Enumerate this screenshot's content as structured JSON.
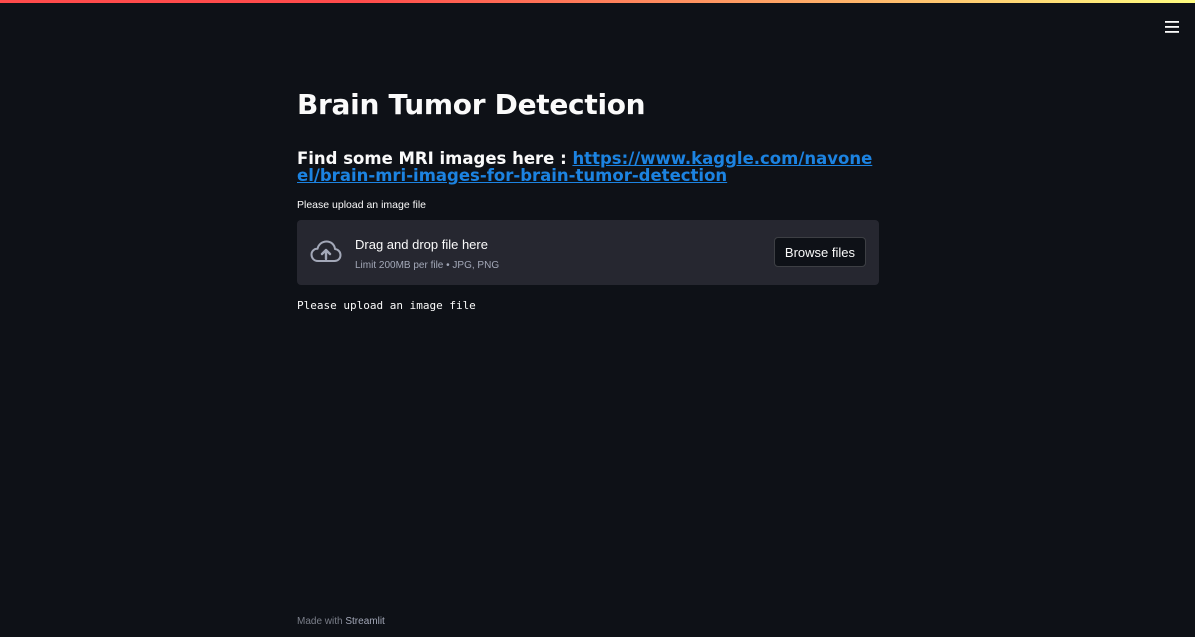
{
  "colors": {
    "background": "#0e1117",
    "dropzone": "#262730",
    "link": "#1c83e1",
    "text": "#fafafa",
    "muted": "#a3a8b8"
  },
  "header": {
    "menu_icon": "hamburger-menu-icon"
  },
  "main": {
    "title": "Brain Tumor Detection",
    "subtitle_prefix": "Find some MRI images here : ",
    "subtitle_link": "https://www.kaggle.com/navoneel/brain-mri-images-for-brain-tumor-detection",
    "uploader": {
      "label": "Please upload an image file",
      "icon": "cloud-upload-icon",
      "drop_text": "Drag and drop file here",
      "limit_text": "Limit 200MB per file • JPG, PNG",
      "browse_label": "Browse files"
    },
    "status_text": "Please upload an image file"
  },
  "footer": {
    "prefix": "Made with ",
    "brand": "Streamlit"
  }
}
